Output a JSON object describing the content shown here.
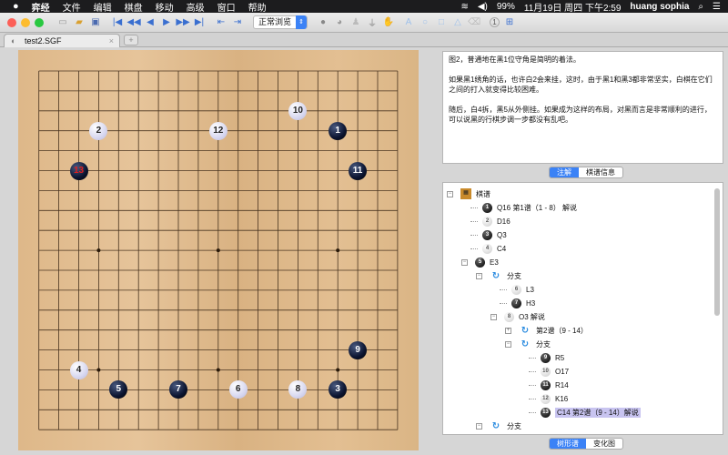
{
  "menubar": {
    "apple": "",
    "items": [
      "弈经",
      "文件",
      "编辑",
      "棋盘",
      "移动",
      "高级",
      "窗口",
      "帮助"
    ],
    "status": {
      "battery": "99%",
      "datetime": "11月19日 周四 下午2:59",
      "user": "huang sophia"
    }
  },
  "toolbar": {
    "mode_select": "正常浏览",
    "move_number_badge": "1"
  },
  "tab": {
    "title": "test2.SGF"
  },
  "board": {
    "size": 19,
    "star_points": [
      "D4",
      "K4",
      "Q4",
      "D10",
      "K10",
      "Q10",
      "D16",
      "K16",
      "Q16"
    ],
    "stones": [
      {
        "n": "1",
        "color": "black",
        "pos": "Q16"
      },
      {
        "n": "2",
        "color": "white",
        "pos": "D16"
      },
      {
        "n": "3",
        "color": "black",
        "pos": "Q3"
      },
      {
        "n": "4",
        "color": "white",
        "pos": "C4"
      },
      {
        "n": "5",
        "color": "black",
        "pos": "E3"
      },
      {
        "n": "6",
        "color": "white",
        "pos": "L3"
      },
      {
        "n": "7",
        "color": "black",
        "pos": "H3"
      },
      {
        "n": "8",
        "color": "white",
        "pos": "O3"
      },
      {
        "n": "9",
        "color": "black",
        "pos": "R5"
      },
      {
        "n": "10",
        "color": "white",
        "pos": "O17"
      },
      {
        "n": "11",
        "color": "black",
        "pos": "R14"
      },
      {
        "n": "12",
        "color": "white",
        "pos": "K16"
      },
      {
        "n": "13",
        "color": "black",
        "pos": "C14",
        "last": true
      }
    ],
    "last_move_color": "#e02020"
  },
  "comment": {
    "paragraphs": [
      "图2，普通地在黑1位守角是简明的着法。",
      "如果黑1绣角的话，也许白2会来挂，这时，由于黑1和黑3都非常坚实，白棋在它们之间的打入就变得比较困难。",
      "随后，白4拆，黑5从外侧挂。如果成为这样的布局，对黑而言是非常顺利的进行，可以说黑的行棋步调一步都没有乱吧。"
    ]
  },
  "comment_tabs": [
    "注解",
    "棋谱信息"
  ],
  "tree": {
    "nodes": [
      {
        "icon": "root",
        "label": "棋谱"
      },
      {
        "icon": "b",
        "n": "1",
        "label": "Q16   第1谱（1 - 8）   解说"
      },
      {
        "icon": "w",
        "n": "2",
        "label": "D16"
      },
      {
        "icon": "b",
        "n": "3",
        "label": "Q3"
      },
      {
        "icon": "w",
        "n": "4",
        "label": "C4"
      },
      {
        "icon": "b",
        "n": "5",
        "label": "E3"
      },
      {
        "icon": "branch",
        "label": "分支"
      },
      {
        "icon": "w",
        "n": "6",
        "label": "L3"
      },
      {
        "icon": "b",
        "n": "7",
        "label": "H3"
      },
      {
        "icon": "w",
        "n": "8",
        "label": "O3   解说"
      },
      {
        "icon": "branch",
        "label": "第2谱（9 - 14）"
      },
      {
        "icon": "branch",
        "label": "分支"
      },
      {
        "icon": "b",
        "n": "9",
        "label": "R5"
      },
      {
        "icon": "w",
        "n": "10",
        "label": "O17"
      },
      {
        "icon": "b",
        "n": "11",
        "label": "R14"
      },
      {
        "icon": "w",
        "n": "12",
        "label": "K16"
      },
      {
        "icon": "b",
        "n": "13",
        "label": "C14   第2谱（9 - 14）解说",
        "selected": true
      },
      {
        "icon": "branch",
        "label": "分支"
      }
    ]
  },
  "tree_tabs": [
    "树形谱",
    "变化图"
  ]
}
